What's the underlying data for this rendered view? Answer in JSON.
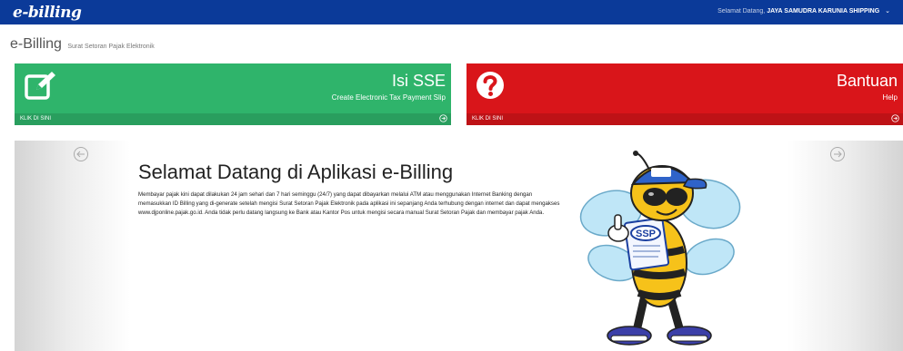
{
  "header": {
    "logo_text": "e-billing",
    "welcome_label": "Selamat Datang,",
    "company_name": "JAYA SAMUDRA KARUNIA SHIPPING",
    "colors": {
      "bar": "#0b3a99"
    }
  },
  "page": {
    "title": "e-Billing",
    "subtitle": "Surat Setoran Pajak Elektronik"
  },
  "tiles": [
    {
      "title": "Isi SSE",
      "subtitle": "Create Electronic Tax Payment Slip",
      "cta": "KLIK DI SINI",
      "icon": "edit-icon",
      "color": "#2fb46b"
    },
    {
      "title": "Bantuan",
      "subtitle": "Help",
      "cta": "KLIK DI SINI",
      "icon": "question-icon",
      "color": "#d9151a"
    }
  ],
  "hero": {
    "title": "Selamat Datang di Aplikasi e-Billing",
    "body": "Membayar pajak kini dapat dilakukan 24 jam sehari dan 7 hari seminggu (24/7) yang dapat dibayarkan melalui ATM atau menggunakan Internet Banking dengan memasukkan ID Billing yang di-generate setelah mengisi Surat Setoran Pajak Elektronik pada aplikasi ini sepanjang Anda terhubung dengan internet dan dapat mengakses www.djponline.pajak.go.id. Anda tidak perlu datang langsung ke Bank atau Kantor Pos untuk mengisi secara manual Surat Setoran Pajak dan membayar pajak Anda.",
    "mascot_label": "SSP"
  }
}
